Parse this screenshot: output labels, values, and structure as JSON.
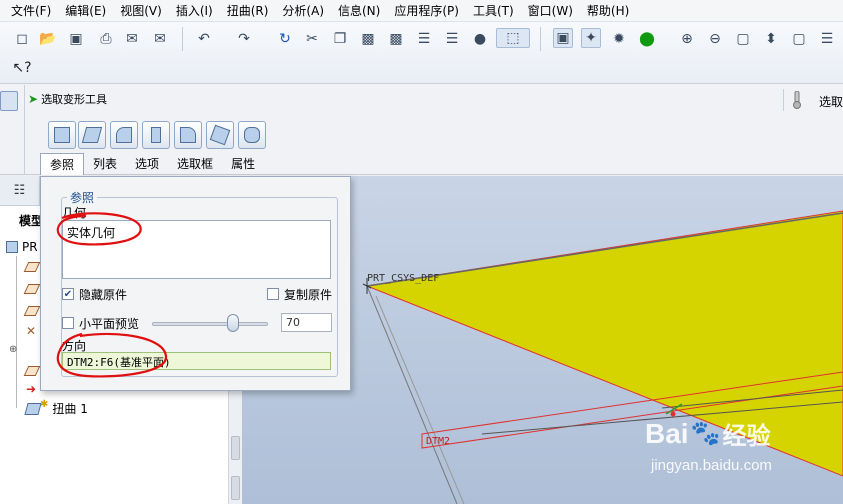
{
  "menu": [
    "文件(F)",
    "编辑(E)",
    "视图(V)",
    "插入(I)",
    "扭曲(R)",
    "分析(A)",
    "信息(N)",
    "应用程序(P)",
    "工具(T)",
    "窗口(W)",
    "帮助(H)"
  ],
  "dashboard": {
    "title": "选取变形工具",
    "tabs": [
      "参照",
      "列表",
      "选项",
      "选取框",
      "属性"
    ],
    "right_label": "选取"
  },
  "model_tree": {
    "header": "模型",
    "root_label": "PR",
    "warp_item": "扭曲 1"
  },
  "panel": {
    "legend": "参照",
    "geometry_label": "几何",
    "geometry_value": "实体几何",
    "hide_original": "隐藏原件",
    "copy_original": "复制原件",
    "small_plane_preview": "小平面预览",
    "preview_value": "70",
    "direction_label": "方向",
    "direction_value": "DTM2:F6(基准平面)",
    "hide_checked": true,
    "copy_checked": false,
    "preview_checked": false,
    "slider_level": 0.7
  },
  "graphics": {
    "csys_label": "PRT_CSYS_DEF",
    "datum_label": "DTM2",
    "surface_color": "#d6d400",
    "edge_color": "#e03030"
  },
  "watermark": {
    "brand_left": "Bai",
    "brand_right": "经验",
    "url": "jingyan.baidu.com"
  }
}
